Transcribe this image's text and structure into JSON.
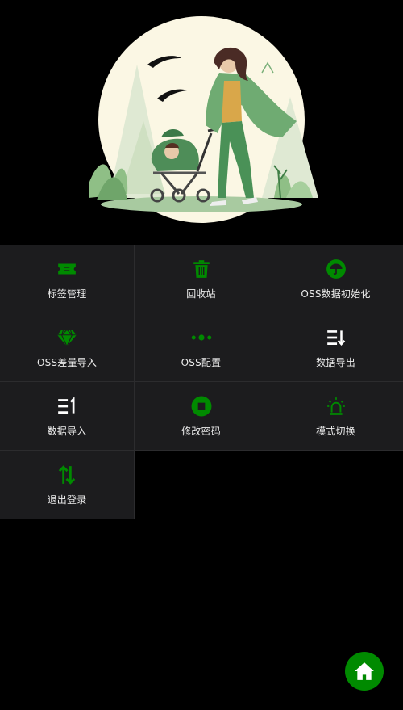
{
  "colors": {
    "accent": "#008a00",
    "background": "#000000",
    "cell": "#1c1c1e",
    "fab": "#008a00"
  },
  "hero": {
    "image": "illustration-mother-with-stroller"
  },
  "menu": {
    "items": [
      {
        "label": "标签管理",
        "icon": "ticket-icon"
      },
      {
        "label": "回收站",
        "icon": "trash-icon"
      },
      {
        "label": "OSS数据初始化",
        "icon": "umbrella-icon"
      },
      {
        "label": "OSS差量导入",
        "icon": "diamond-icon"
      },
      {
        "label": "OSS配置",
        "icon": "dots-icon"
      },
      {
        "label": "数据导出",
        "icon": "sort-list-icon"
      },
      {
        "label": "数据导入",
        "icon": "list-number-icon"
      },
      {
        "label": "修改密码",
        "icon": "stop-circle-icon"
      },
      {
        "label": "模式切换",
        "icon": "alarm-light-icon"
      },
      {
        "label": "退出登录",
        "icon": "swap-vertical-icon"
      }
    ]
  },
  "fab": {
    "icon": "home-icon"
  }
}
